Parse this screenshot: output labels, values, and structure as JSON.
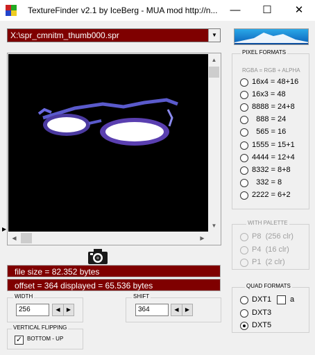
{
  "window": {
    "title": "TextureFinder v2.1 by IceBerg - MUA mod http://n...",
    "minimize": "—",
    "maximize": "☐",
    "close": "✕"
  },
  "path_combo": {
    "value": "X:\\spr_cmnitm_thumb000.spr",
    "arrow": "▼"
  },
  "preview": {
    "scroll_up": "▲",
    "scroll_down": "▼",
    "scroll_left": "◀",
    "scroll_right": "▶",
    "corner_arrow": "▶"
  },
  "info": {
    "file_size": "file size = 82.352 bytes",
    "offset_displayed": "offset = 364   displayed = 65.536 bytes"
  },
  "width_group": {
    "label": "WIDTH",
    "value": "256",
    "dec": "◀",
    "inc": "▶"
  },
  "shift_group": {
    "label": "SHIFT",
    "value": "364",
    "dec": "◀",
    "inc": "▶"
  },
  "vflip_group": {
    "label": "VERTICAL FLIPPING",
    "checkbox_label": "BOTTOM - UP",
    "checked": true,
    "check_mark": "✓"
  },
  "pixel_formats": {
    "label": "PIXEL FORMATS",
    "sublabel": "RGBA = RGB + ALPHA",
    "options": [
      "16x4 = 48+16",
      "16x3 = 48",
      "8888 = 24+8",
      "  888 = 24",
      "  565 = 16",
      "1555 = 15+1",
      "4444 = 12+4",
      "8332 = 8+8",
      "  332 = 8",
      "2222 = 6+2"
    ]
  },
  "palette": {
    "label": "WITH PALETTE",
    "options": [
      "P8  (256 clr)",
      "P4  (16 clr)",
      "P1  (2 clr)"
    ]
  },
  "quad_formats": {
    "label": "QUAD FORMATS",
    "options": [
      "DXT1",
      "DXT3",
      "DXT5"
    ],
    "selected": "DXT5",
    "alpha_checkbox_label": "a"
  },
  "colors": {
    "info_bar": "#7f0000",
    "logo_top": "#2aa8e8",
    "logo_bottom": "#0a5fb8"
  },
  "icons": {
    "app": "texturefinder-app-icon",
    "camera": "camera-icon",
    "logo": "iceberg-logo"
  }
}
